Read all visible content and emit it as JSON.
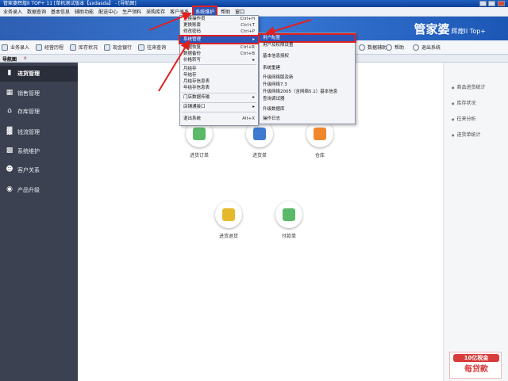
{
  "window": {
    "title": "管家婆辉煌II TOP+ 11 [单机测试版本【sxdasda】 - [导航图]"
  },
  "menubar": {
    "items": [
      "业务录入",
      "数据查询",
      "基本信息",
      "辅助功能",
      "配送中心",
      "生产领料",
      "采购库存",
      "客户关系",
      "系统维护",
      "帮助",
      "窗口"
    ]
  },
  "brand": {
    "name": "管家婆",
    "edition": "辉煌II Top+"
  },
  "toolbar": {
    "items": [
      "业务录入",
      "经营历程",
      "库存状况",
      "现金银行",
      "往来查询"
    ],
    "right_items": [
      "帮助",
      "退出系统"
    ],
    "mid_right": "数据辅助"
  },
  "nav": {
    "tab": "导航图",
    "close": "x"
  },
  "sidebar": {
    "items": [
      {
        "label": "进货管理",
        "icon": "truck-icon"
      },
      {
        "label": "销售管理",
        "icon": "sales-icon"
      },
      {
        "label": "存库管理",
        "icon": "warehouse-icon"
      },
      {
        "label": "钱流管理",
        "icon": "chart-icon"
      },
      {
        "label": "系统维护",
        "icon": "monitor-icon"
      },
      {
        "label": "客户关系",
        "icon": "user-icon"
      },
      {
        "label": "产品升级",
        "icon": "upgrade-icon"
      }
    ]
  },
  "main": {
    "tiles": [
      {
        "label": "进货订单",
        "color": "#5bb96a"
      },
      {
        "label": "进货单",
        "color": "#3d7ad0"
      },
      {
        "label": "仓库",
        "color": "#f0872c"
      },
      {
        "label": "进货退货",
        "color": "#e6b92c"
      },
      {
        "label": "付款单",
        "color": "#5bb96a"
      }
    ]
  },
  "rightpanel": {
    "items": [
      "商品进货统计",
      "库存状况",
      "往来分析",
      "进货单统计"
    ]
  },
  "dropdown": {
    "items": [
      {
        "label": "更换操作员",
        "shortcut": "Ctrl+H"
      },
      {
        "label": "更换账套",
        "shortcut": "Ctrl+T"
      },
      {
        "label": "修改密码",
        "shortcut": "Ctrl+P"
      },
      {
        "label": "系统管理",
        "shortcut": "▸"
      },
      {
        "label": "数据恢复",
        "shortcut": "Ctrl+R"
      },
      {
        "label": "数据备份",
        "shortcut": "Ctrl+B"
      },
      {
        "label": "价格转写",
        "shortcut": "▸"
      },
      {
        "label": "月结存",
        "shortcut": ""
      },
      {
        "label": "年结存",
        "shortcut": ""
      },
      {
        "label": "月结存信息表",
        "shortcut": ""
      },
      {
        "label": "年结存信息表",
        "shortcut": ""
      },
      {
        "label": "门店数据传输",
        "shortcut": "▸"
      },
      {
        "label": "店铺通接口",
        "shortcut": "▸"
      },
      {
        "label": "退出系统",
        "shortcut": "Alt+X"
      }
    ]
  },
  "submenu": {
    "items": [
      "用户配置",
      "用户及权限设置",
      "基本信息授权",
      "系统重建",
      "升级网络版及新",
      "升级网络7.3",
      "升级网络2005（含网络5.1）基本信息",
      "查询调试器",
      "升级数据库",
      "操作日志"
    ]
  },
  "badge": {
    "top": "10亿税金",
    "bottom": "每贷款"
  }
}
